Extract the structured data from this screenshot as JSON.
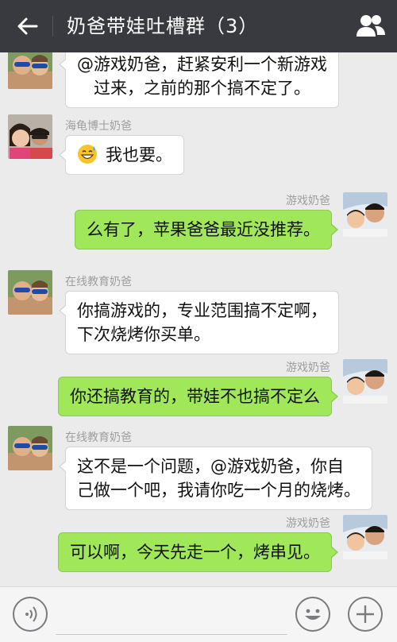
{
  "header": {
    "title": "奶爸带娃吐槽群（3）"
  },
  "messages": [
    {
      "side": "left",
      "sender": "",
      "lines": [
        "@游戏奶爸，赶紧安利一个新游戏",
        "　过来，之前的那个搞不定了。"
      ]
    },
    {
      "side": "left",
      "sender": "海龟博士奶爸",
      "emoji": "grinning-sweat-emoji",
      "lines": [
        "我也要。"
      ]
    },
    {
      "side": "right",
      "sender": "游戏奶爸",
      "lines": [
        "么有了，苹果爸爸最近没推荐。"
      ]
    },
    {
      "side": "left",
      "sender": "在线教育奶爸",
      "lines": [
        "你搞游戏的，专业范围搞不定啊，",
        "下次烧烤你买单。"
      ]
    },
    {
      "side": "right",
      "sender": "游戏奶爸",
      "lines": [
        "你还搞教育的，带娃不也搞不定么"
      ]
    },
    {
      "side": "left",
      "sender": "在线教育奶爸",
      "lines": [
        "这不是一个问题，@游戏奶爸，你自",
        "己做一个吧，我请你吃一个月的烧烤。"
      ]
    },
    {
      "side": "right",
      "sender": "游戏奶爸",
      "lines": [
        "可以啊，今天先走一个，烤串见。"
      ]
    }
  ],
  "colors": {
    "topbar": "#393a3f",
    "chat_background": "#ebebeb",
    "own_bubble": "#a0e75a",
    "other_bubble": "#ffffff",
    "sender_name": "#9e9e9e"
  }
}
